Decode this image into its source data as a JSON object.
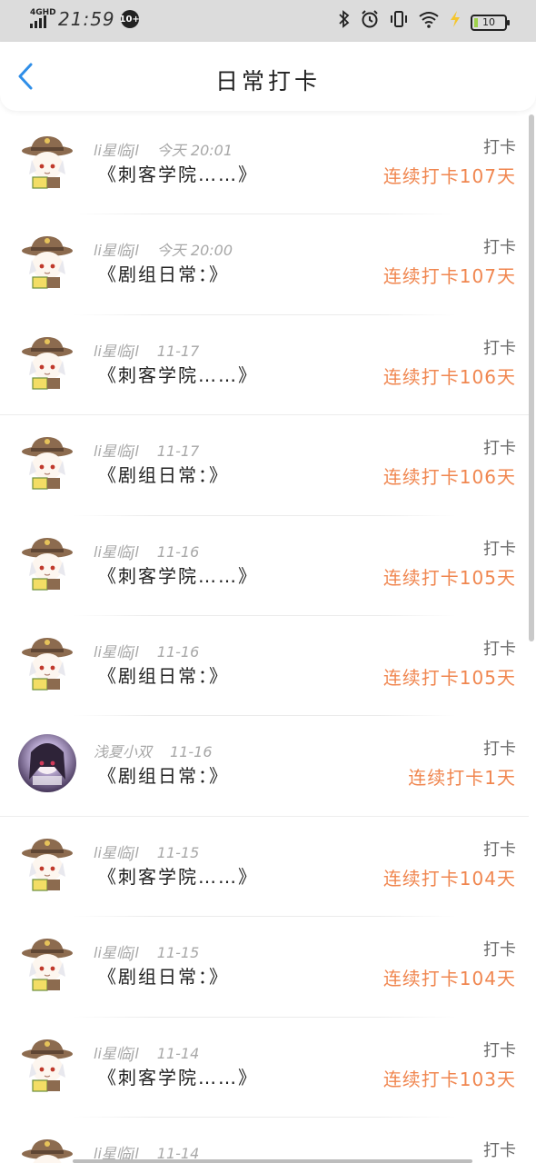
{
  "status_bar": {
    "network": "4GHD",
    "time": "21:59",
    "badge": "10+",
    "battery": "10",
    "icons": [
      "bluetooth-icon",
      "alarm-icon",
      "vibrate-icon",
      "wifi-icon",
      "charging-icon"
    ]
  },
  "header": {
    "back_icon": "chevron-left-icon",
    "title": "日常打卡"
  },
  "colors": {
    "accent": "#2f8ee8",
    "streak": "#f0864f",
    "meta": "#a8a8a8"
  },
  "items": [
    {
      "user": "li星临jl",
      "time": "今天 20:01",
      "content": "《刺客学院……》",
      "action": "打卡",
      "streak": "连续打卡107天",
      "avatar": "cartoon-hat-avatar"
    },
    {
      "user": "li星临jl",
      "time": "今天 20:00",
      "content": "《剧组日常：》",
      "action": "打卡",
      "streak": "连续打卡107天",
      "avatar": "cartoon-hat-avatar"
    },
    {
      "user": "li星临jl",
      "time": "11-17",
      "content": "《刺客学院……》",
      "action": "打卡",
      "streak": "连续打卡106天",
      "avatar": "cartoon-hat-avatar"
    },
    {
      "user": "li星临jl",
      "time": "11-17",
      "content": "《剧组日常：》",
      "action": "打卡",
      "streak": "连续打卡106天",
      "avatar": "cartoon-hat-avatar"
    },
    {
      "user": "li星临jl",
      "time": "11-16",
      "content": "《刺客学院……》",
      "action": "打卡",
      "streak": "连续打卡105天",
      "avatar": "cartoon-hat-avatar"
    },
    {
      "user": "li星临jl",
      "time": "11-16",
      "content": "《剧组日常：》",
      "action": "打卡",
      "streak": "连续打卡105天",
      "avatar": "cartoon-hat-avatar"
    },
    {
      "user": "浅夏小双",
      "time": "11-16",
      "content": "《剧组日常：》",
      "action": "打卡",
      "streak": "连续打卡1天",
      "avatar": "anime-girl-avatar"
    },
    {
      "user": "li星临jl",
      "time": "11-15",
      "content": "《刺客学院……》",
      "action": "打卡",
      "streak": "连续打卡104天",
      "avatar": "cartoon-hat-avatar"
    },
    {
      "user": "li星临jl",
      "time": "11-15",
      "content": "《剧组日常：》",
      "action": "打卡",
      "streak": "连续打卡104天",
      "avatar": "cartoon-hat-avatar"
    },
    {
      "user": "li星临jl",
      "time": "11-14",
      "content": "《刺客学院……》",
      "action": "打卡",
      "streak": "连续打卡103天",
      "avatar": "cartoon-hat-avatar"
    },
    {
      "user": "li星临jl",
      "time": "11-14",
      "content": "",
      "action": "打卡",
      "streak": "",
      "avatar": "cartoon-hat-avatar"
    }
  ]
}
